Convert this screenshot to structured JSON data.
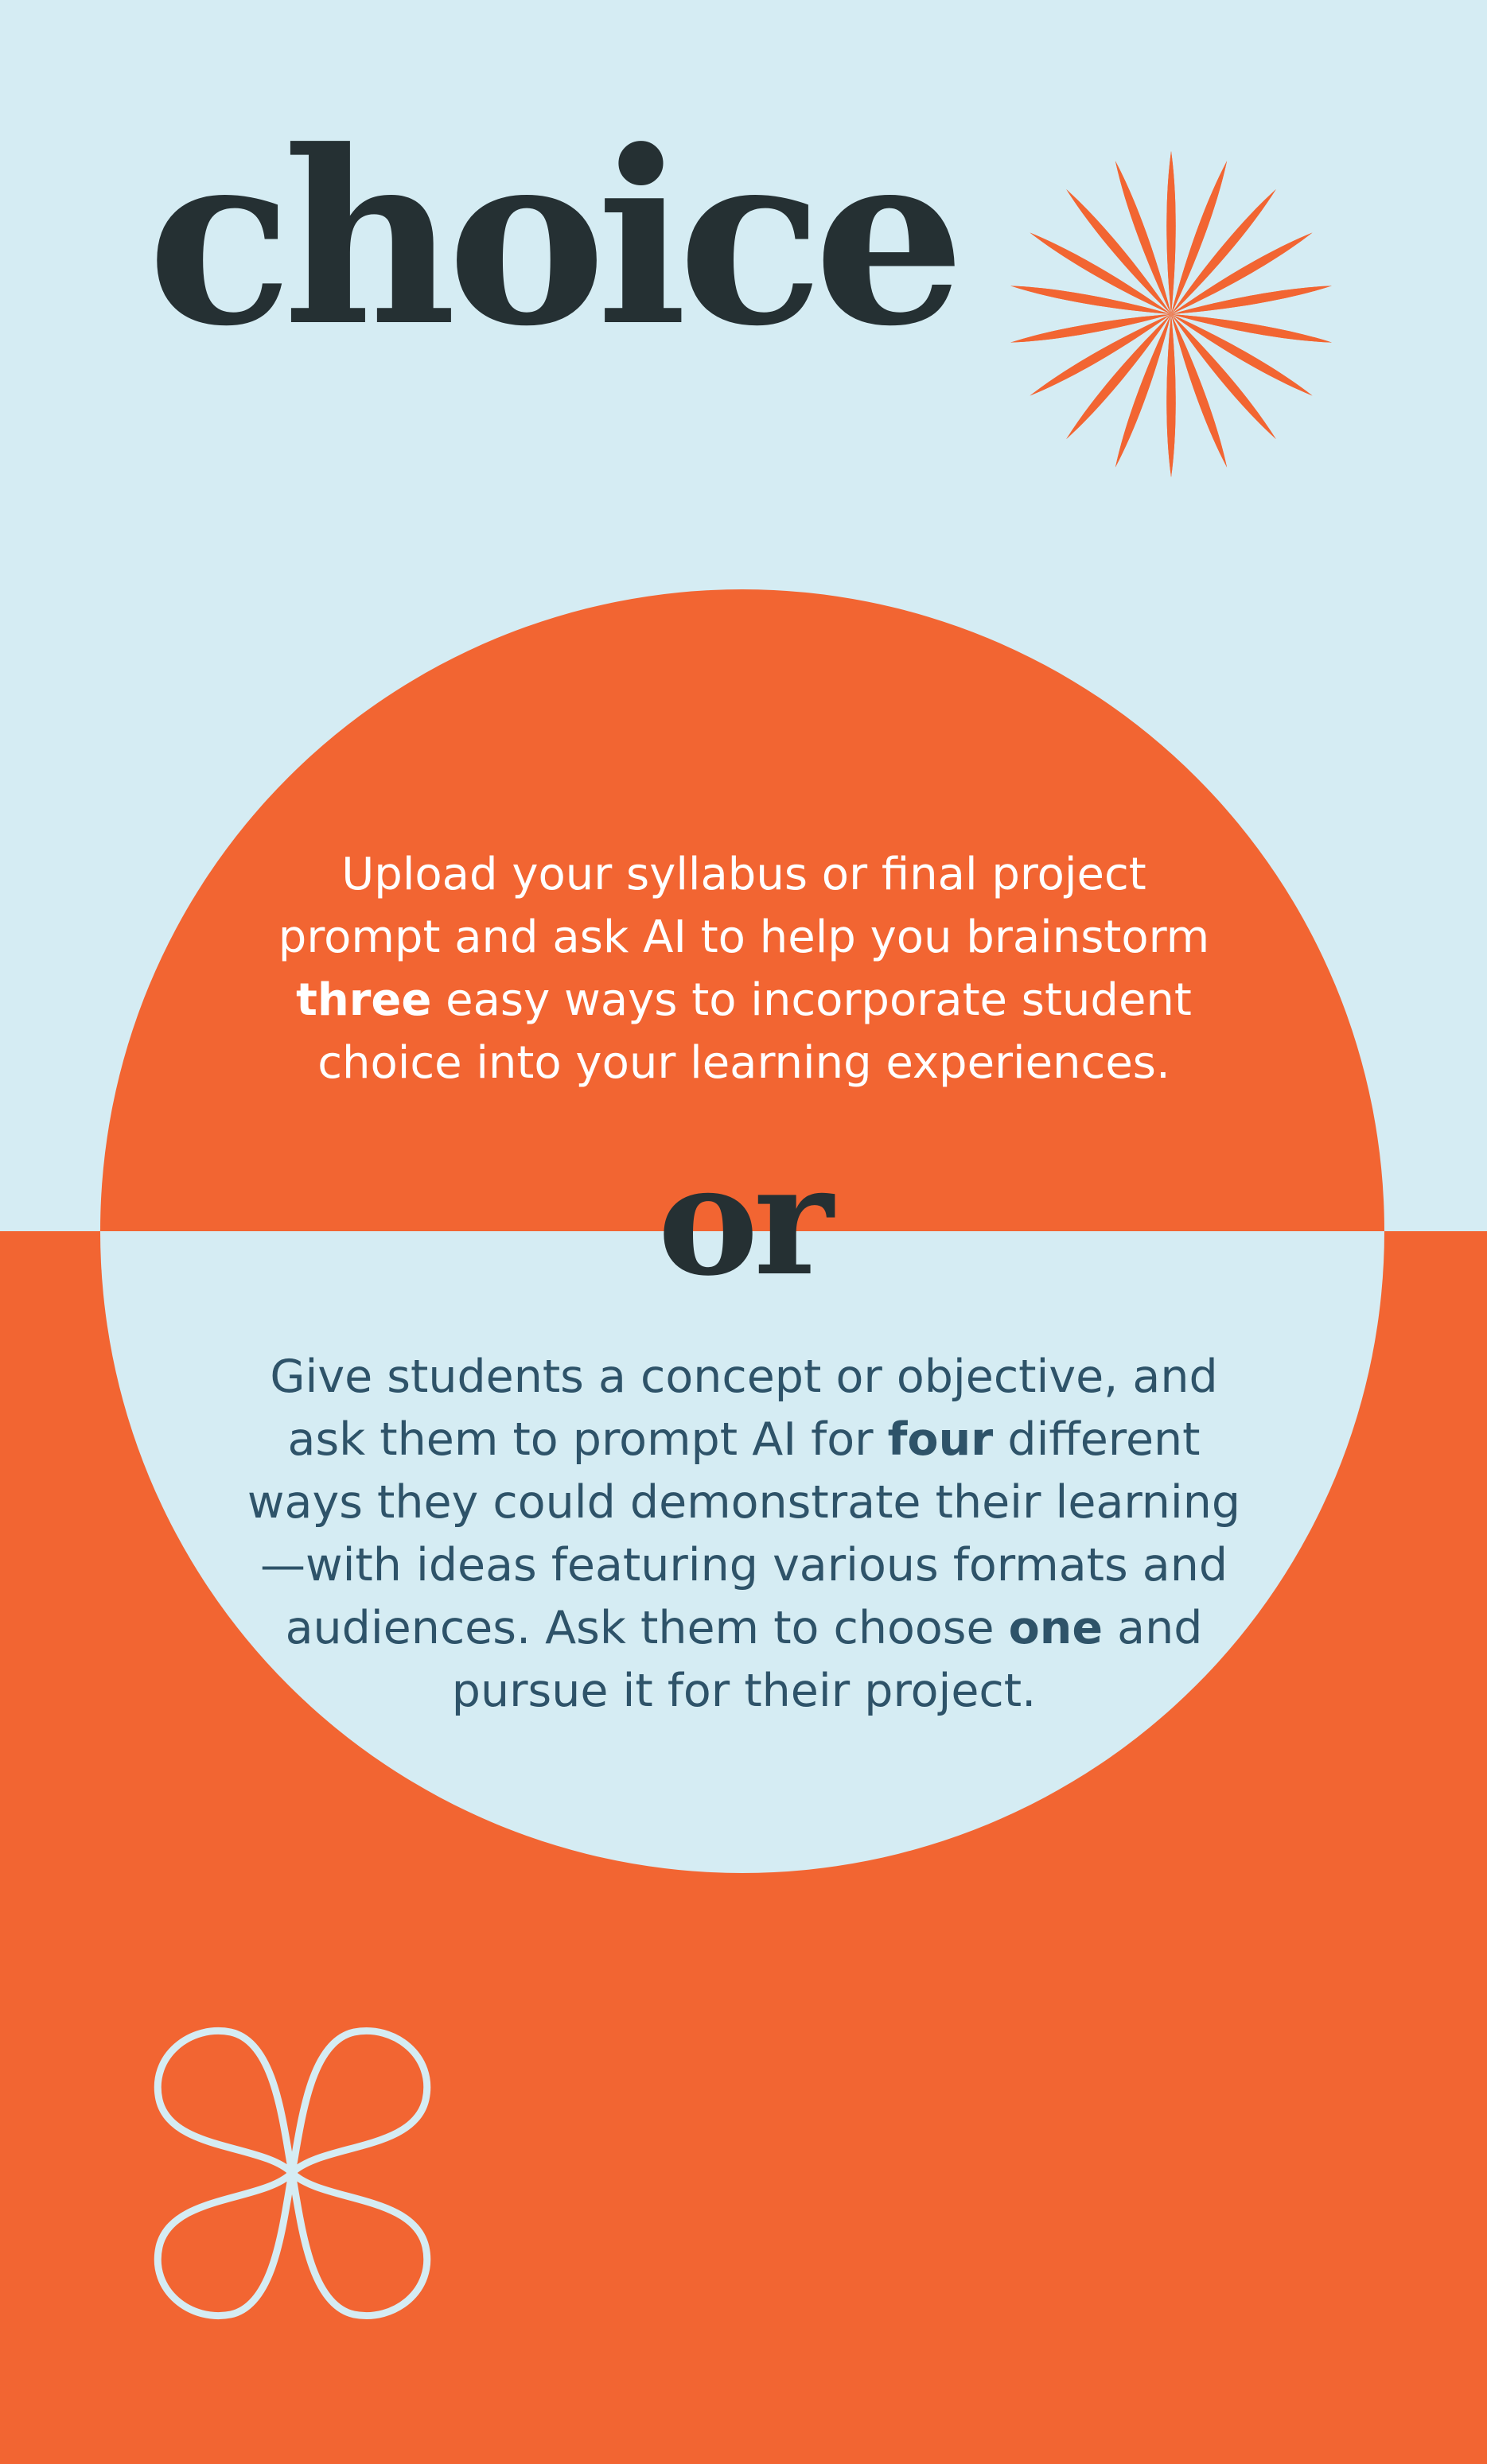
{
  "title": "choice",
  "top_text": {
    "line1": "Upload your syllabus or final project",
    "line2": "prompt and ask AI to help you brainstorm",
    "line3_bold": "three",
    "line3_rest": " easy ways to incorporate student",
    "line4": "choice into your learning experiences."
  },
  "separator_word": "or",
  "bottom_text": {
    "line1": "Give students a concept or objective, and",
    "line2_pre": "ask them to prompt AI for ",
    "line2_bold": "four",
    "line2_post": " different",
    "line3": "ways they could demonstrate their learning",
    "line4": "—with ideas featuring various formats and",
    "line5_pre": "audiences. Ask them to choose ",
    "line5_bold": "one",
    "line5_post": " and",
    "line6": "pursue it for their project."
  },
  "icons": {
    "burst": "sunburst-icon",
    "clover": "four-petal-flower-icon"
  },
  "colors": {
    "light_blue": "#D5ECF3",
    "orange": "#F26532",
    "dark_text": "#253033",
    "blue_text": "#2E5369",
    "white": "#FFFFFF"
  }
}
